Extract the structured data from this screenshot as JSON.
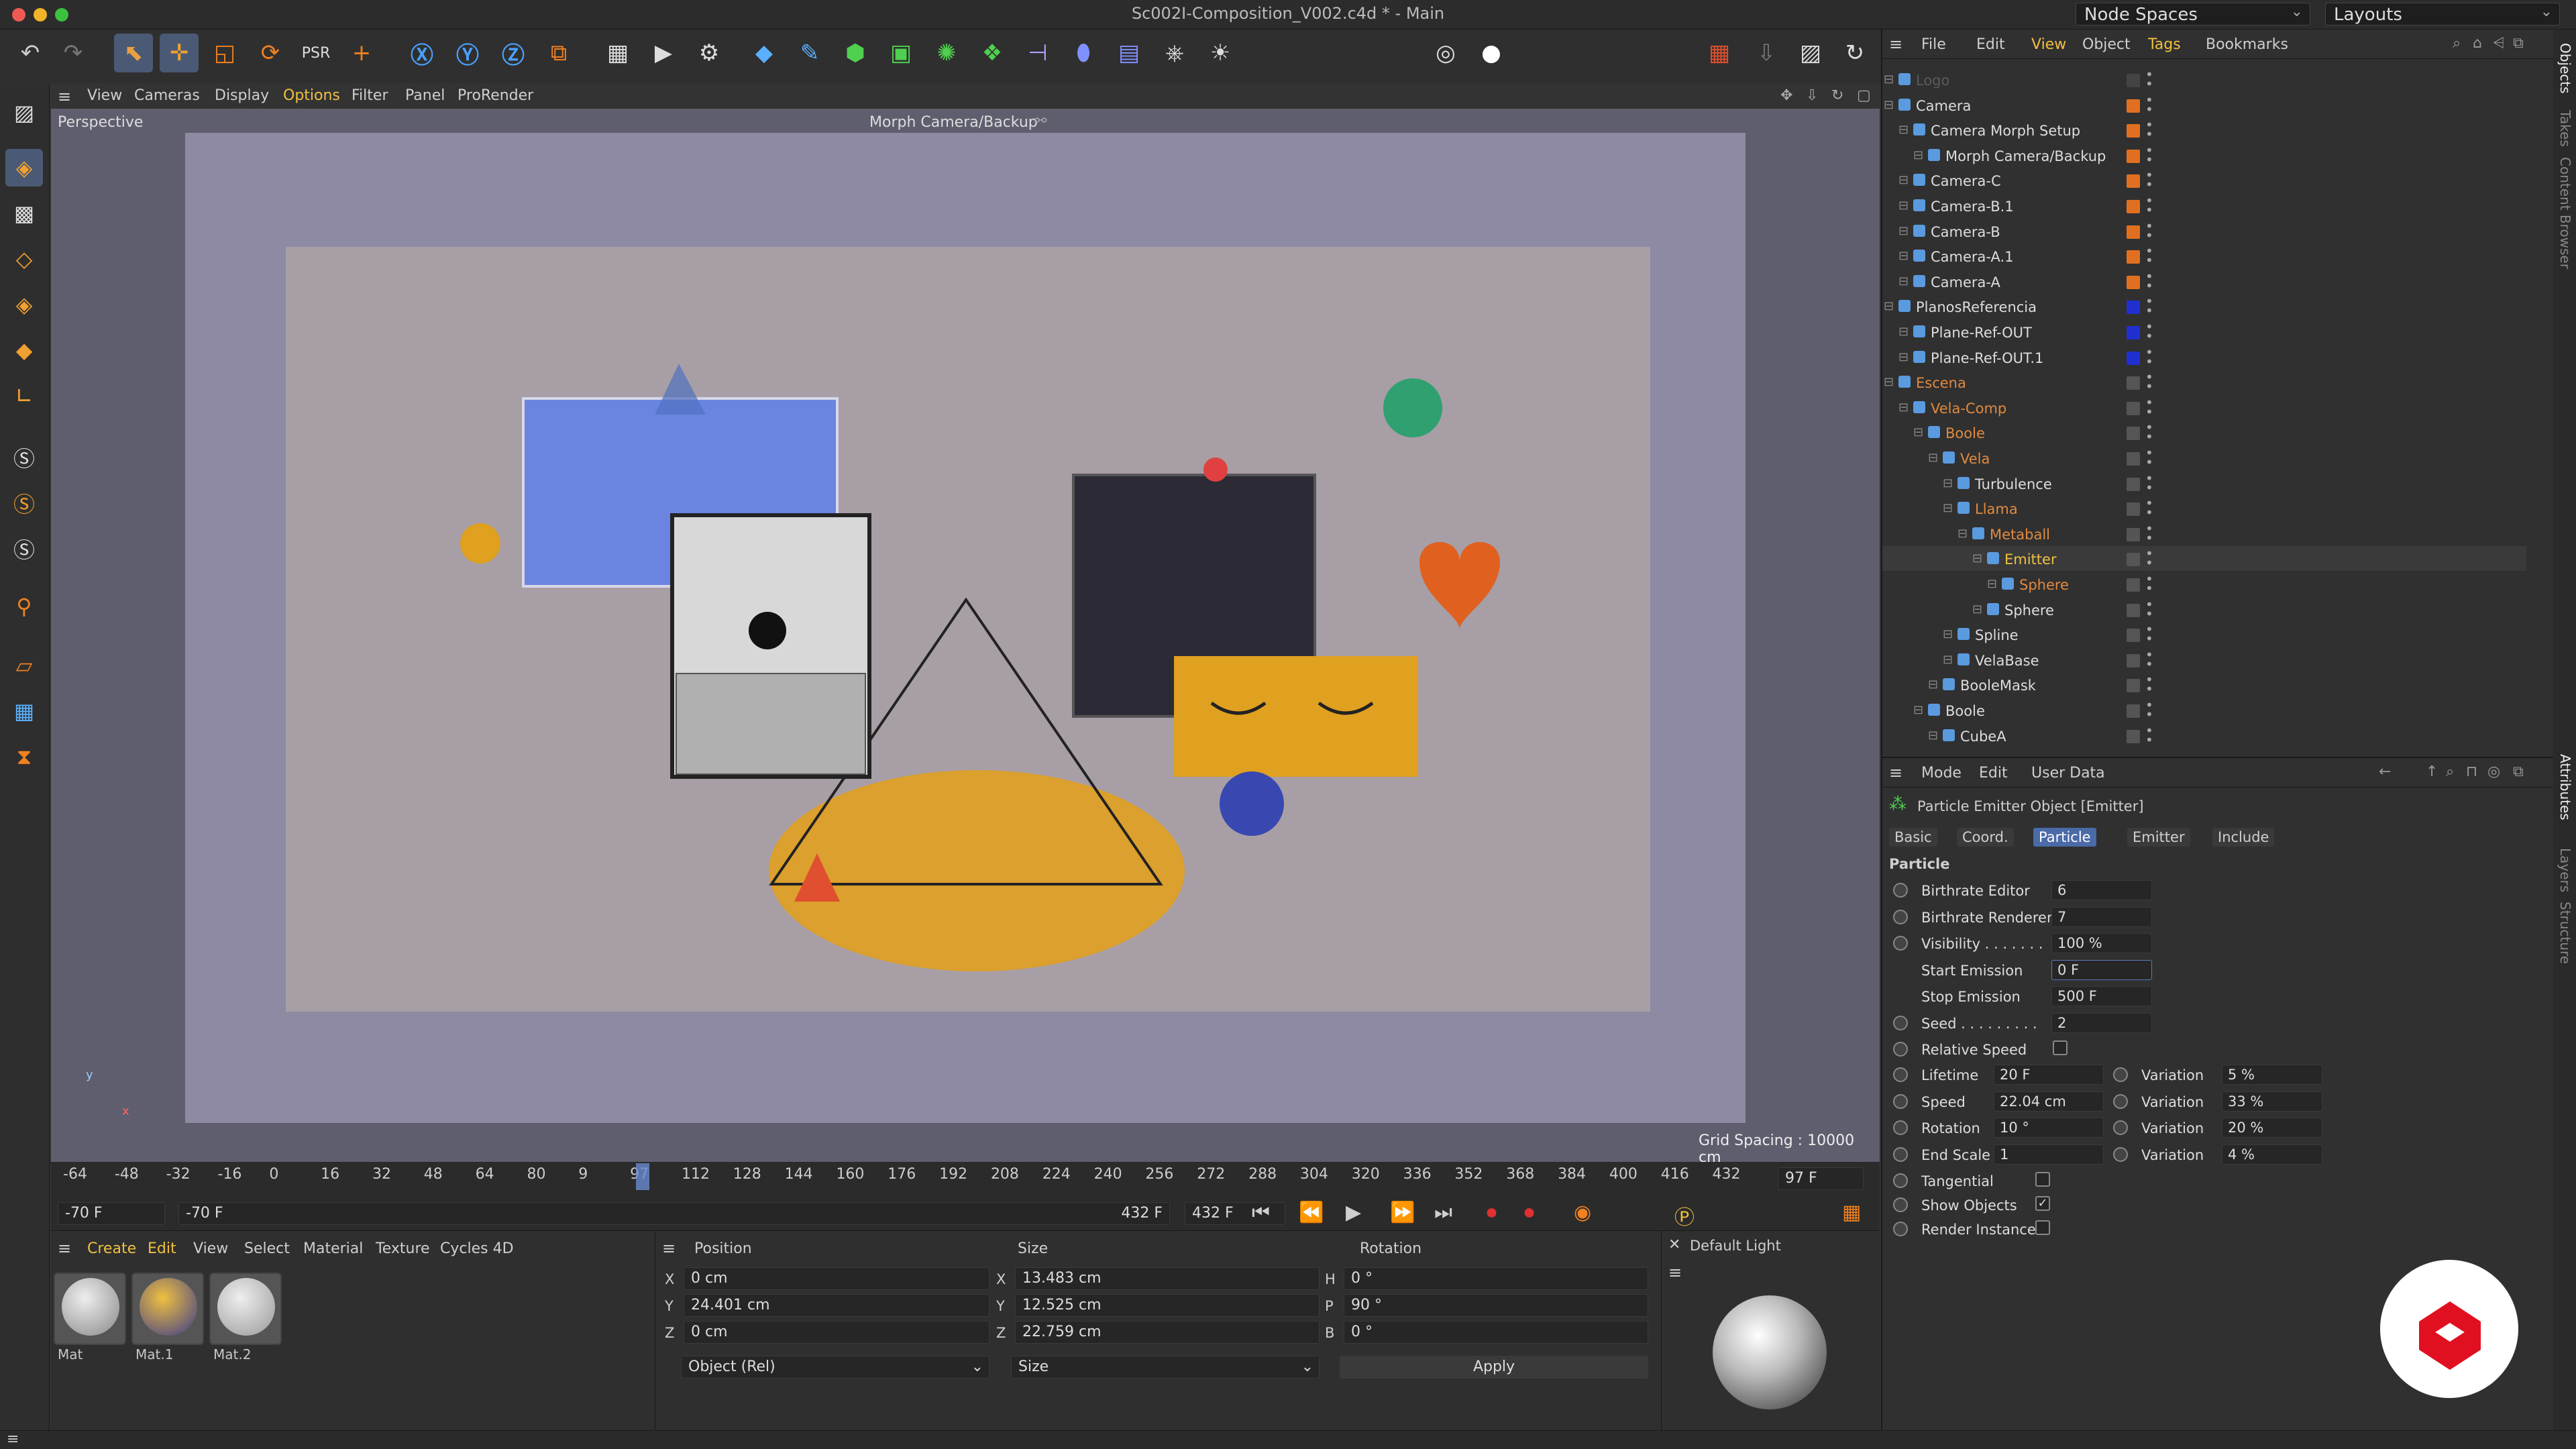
{
  "window": {
    "title": "Sc002I-Composition_V002.c4d * - Main"
  },
  "top_dropdowns": {
    "node_spaces": "Node Spaces",
    "layouts": "Layouts"
  },
  "toolbar_icons": [
    "undo-icon",
    "redo-icon",
    "select-icon",
    "move-icon",
    "scale-icon",
    "rotate-icon",
    "psr-icon",
    "add-icon",
    "x-axis-icon",
    "y-axis-icon",
    "z-axis-icon",
    "coord-system-icon",
    "render-region-icon",
    "render-view-icon",
    "render-settings-icon",
    "cube-icon",
    "pen-icon",
    "subdivision-icon",
    "extrude-icon",
    "mograph-icon",
    "cloner-icon",
    "deformer-icon",
    "field-icon",
    "floor-icon",
    "camera-icon",
    "light-icon"
  ],
  "viewport_menu": {
    "view": "View",
    "cameras": "Cameras",
    "display": "Display",
    "options": "Options",
    "filter": "Filter",
    "panel": "Panel",
    "prorender": "ProRender"
  },
  "viewport": {
    "name": "Perspective",
    "camera": "Morph Camera/Backup",
    "grid_spacing": "Grid Spacing : 10000 cm"
  },
  "timeline": {
    "ticks": [
      "-64",
      "-48",
      "-32",
      "-16",
      "0",
      "16",
      "32",
      "48",
      "64",
      "80",
      "9",
      "97",
      "112",
      "128",
      "144",
      "160",
      "176",
      "192",
      "208",
      "224",
      "240",
      "256",
      "272",
      "288",
      "304",
      "320",
      "336",
      "352",
      "368",
      "384",
      "400",
      "416",
      "432"
    ],
    "current_frame": "97 F",
    "start_field": "-70 F",
    "range_start": "-70 F",
    "range_end": "432 F",
    "end_field": "432 F"
  },
  "material_manager": {
    "menu": {
      "create": "Create",
      "edit": "Edit",
      "view": "View",
      "select": "Select",
      "material": "Material",
      "texture": "Texture",
      "cycles": "Cycles 4D"
    },
    "materials": [
      "Mat",
      "Mat.1",
      "Mat.2"
    ]
  },
  "coordinates": {
    "headers": {
      "position": "Position",
      "size": "Size",
      "rotation": "Rotation"
    },
    "rows": [
      {
        "axis": "X",
        "pos": "0 cm",
        "size_axis": "X",
        "size": "13.483 cm",
        "rot_axis": "H",
        "rot": "0 °"
      },
      {
        "axis": "Y",
        "pos": "24.401 cm",
        "size_axis": "Y",
        "size": "12.525 cm",
        "rot_axis": "P",
        "rot": "90 °"
      },
      {
        "axis": "Z",
        "pos": "0 cm",
        "size_axis": "Z",
        "size": "22.759 cm",
        "rot_axis": "B",
        "rot": "0 °"
      }
    ],
    "mode": "Object (Rel)",
    "size_mode": "Size",
    "apply": "Apply"
  },
  "default_light": {
    "title": "Default Light"
  },
  "object_manager": {
    "menu": {
      "file": "File",
      "edit": "Edit",
      "view": "View",
      "object": "Object",
      "tags": "Tags",
      "bookmarks": "Bookmarks"
    },
    "rows": [
      {
        "name": "Logo",
        "depth": 0,
        "color": "#5a5a5a",
        "sw": "#444"
      },
      {
        "name": "Camera",
        "depth": 0,
        "color": "#dddddd",
        "sw": "#e07020"
      },
      {
        "name": "Camera Morph Setup",
        "depth": 1,
        "color": "#dddddd",
        "sw": "#e07020"
      },
      {
        "name": "Morph Camera/Backup",
        "depth": 2,
        "color": "#dddddd",
        "sw": "#e07020"
      },
      {
        "name": "Camera-C",
        "depth": 1,
        "color": "#dddddd",
        "sw": "#e07020"
      },
      {
        "name": "Camera-B.1",
        "depth": 1,
        "color": "#dddddd",
        "sw": "#e07020"
      },
      {
        "name": "Camera-B",
        "depth": 1,
        "color": "#dddddd",
        "sw": "#e07020"
      },
      {
        "name": "Camera-A.1",
        "depth": 1,
        "color": "#dddddd",
        "sw": "#e07020"
      },
      {
        "name": "Camera-A",
        "depth": 1,
        "color": "#dddddd",
        "sw": "#e07020"
      },
      {
        "name": "PlanosReferencia",
        "depth": 0,
        "color": "#dddddd",
        "sw": "#2030d0"
      },
      {
        "name": "Plane-Ref-OUT",
        "depth": 1,
        "color": "#dddddd",
        "sw": "#2030d0"
      },
      {
        "name": "Plane-Ref-OUT.1",
        "depth": 1,
        "color": "#dddddd",
        "sw": "#2030d0"
      },
      {
        "name": "Escena",
        "depth": 0,
        "color": "#e08a40",
        "sw": "#555"
      },
      {
        "name": "Vela-Comp",
        "depth": 1,
        "color": "#e08a40",
        "sw": "#555"
      },
      {
        "name": "Boole",
        "depth": 2,
        "color": "#e08a40",
        "sw": "#555"
      },
      {
        "name": "Vela",
        "depth": 3,
        "color": "#e08a40",
        "sw": "#555"
      },
      {
        "name": "Turbulence",
        "depth": 4,
        "color": "#dddddd",
        "sw": "#555"
      },
      {
        "name": "Llama",
        "depth": 4,
        "color": "#e08a40",
        "sw": "#555"
      },
      {
        "name": "Metaball",
        "depth": 5,
        "color": "#e08a40",
        "sw": "#555"
      },
      {
        "name": "Emitter",
        "depth": 6,
        "color": "#f0c040",
        "sw": "#555"
      },
      {
        "name": "Sphere",
        "depth": 7,
        "color": "#e08a40",
        "sw": "#555"
      },
      {
        "name": "Sphere",
        "depth": 6,
        "color": "#dddddd",
        "sw": "#555"
      },
      {
        "name": "Spline",
        "depth": 4,
        "color": "#dddddd",
        "sw": "#555"
      },
      {
        "name": "VelaBase",
        "depth": 4,
        "color": "#dddddd",
        "sw": "#555"
      },
      {
        "name": "BooleMask",
        "depth": 3,
        "color": "#dddddd",
        "sw": "#555"
      },
      {
        "name": "Boole",
        "depth": 2,
        "color": "#dddddd",
        "sw": "#555"
      },
      {
        "name": "CubeA",
        "depth": 3,
        "color": "#dddddd",
        "sw": "#555"
      }
    ]
  },
  "attributes": {
    "menu": {
      "mode": "Mode",
      "edit": "Edit",
      "user_data": "User Data"
    },
    "object_title": "Particle Emitter Object [Emitter]",
    "tabs": [
      "Basic",
      "Coord.",
      "Particle",
      "Emitter",
      "Include"
    ],
    "active_tab": "Particle",
    "section": "Particle",
    "params": [
      {
        "label": "Birthrate Editor",
        "value": "6"
      },
      {
        "label": "Birthrate Renderer",
        "value": "7"
      },
      {
        "label": "Visibility . . . . . . .",
        "value": "100 %"
      },
      {
        "label": "Start Emission",
        "value": "0 F"
      },
      {
        "label": "Stop Emission",
        "value": "500 F"
      },
      {
        "label": "Seed . . . . . . . . .",
        "value": "2"
      }
    ],
    "relative_speed": "Relative Speed",
    "pairs": [
      {
        "label": "Lifetime",
        "value": "20 F",
        "var": "5 %"
      },
      {
        "label": "Speed",
        "value": "22.04 cm",
        "var": "33 %"
      },
      {
        "label": "Rotation",
        "value": "10 °",
        "var": "20 %"
      },
      {
        "label": "End Scale",
        "value": "1",
        "var": "4 %"
      }
    ],
    "variation_label": "Variation",
    "tangential": "Tangential",
    "show_objects": "Show Objects",
    "render_instance": "Render Instance"
  },
  "right_tabs": [
    "Objects",
    "Takes",
    "Content Browser",
    "Attributes",
    "Layers",
    "Structure"
  ]
}
